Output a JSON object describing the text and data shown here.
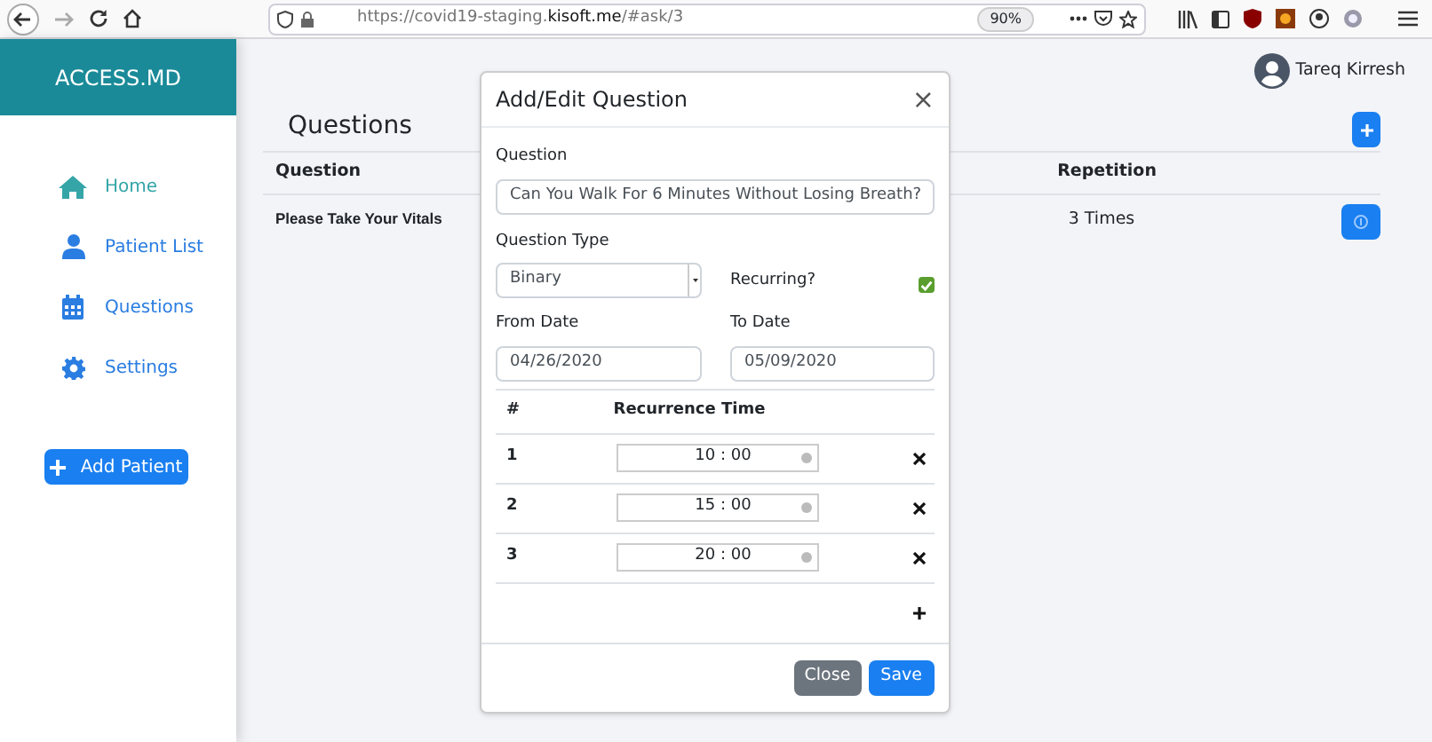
{
  "browser": {
    "url_start": "https://covid19-staging.",
    "url_domain": "kisoft.me",
    "url_path": "/#ask/3",
    "zoom": "90%"
  },
  "sidebar": {
    "brand": "ACCESS.MD",
    "items": [
      {
        "label": "Home",
        "kind": "home",
        "selected": true
      },
      {
        "label": "Patient List",
        "kind": "user",
        "selected": false
      },
      {
        "label": "Questions",
        "kind": "calendar",
        "selected": false
      },
      {
        "label": "Settings",
        "kind": "gear",
        "selected": false
      }
    ],
    "add_button": "Add Patient"
  },
  "user": {
    "name": "Tareq Kirresh"
  },
  "page": {
    "title": "Questions",
    "columns": [
      "Question",
      "Repetition"
    ],
    "rows": [
      {
        "question": "Please Take Your Vitals",
        "repetition": "3 Times"
      }
    ]
  },
  "modal": {
    "title": "Add/Edit Question",
    "close_icon": "×",
    "question_label": "Question",
    "question_value": "Can You Walk For 6 Minutes Without Losing Breath?",
    "type_label": "Question Type",
    "type_value": "Binary",
    "recurring_label": "Recurring?",
    "recurring": true,
    "from_label": "From Date",
    "from_value": "04/26/2020",
    "to_label": "To Date",
    "to_value": "05/09/2020",
    "time_columns": [
      "#",
      "Recurrence Time"
    ],
    "times": [
      {
        "index": "1",
        "time": "10 : 00"
      },
      {
        "index": "2",
        "time": "15 : 00"
      },
      {
        "index": "3",
        "time": "20 : 00"
      }
    ],
    "close_button": "Close",
    "save_button": "Save"
  }
}
